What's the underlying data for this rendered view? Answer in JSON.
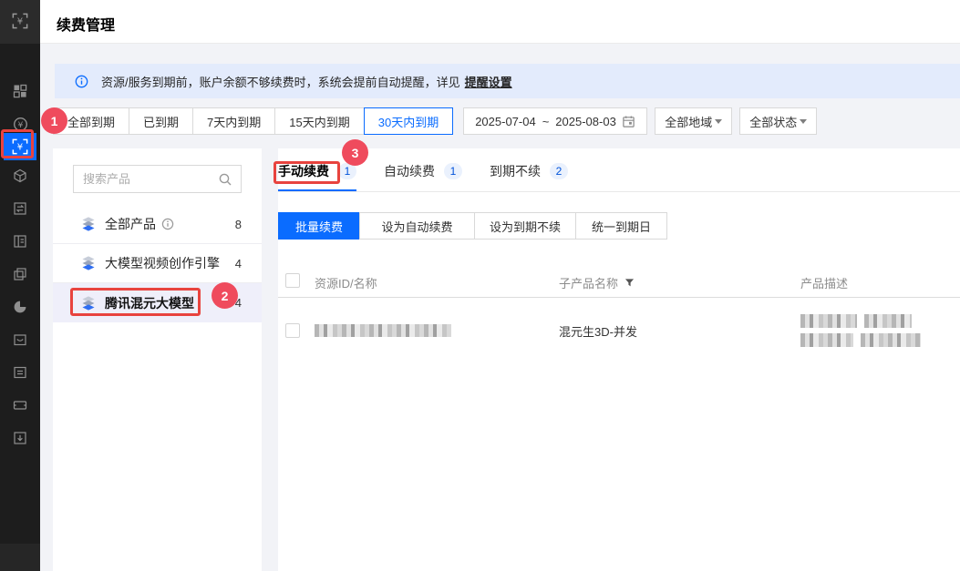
{
  "colors": {
    "accent_blue": "#0a6cff",
    "count_blue": "#0052d9",
    "annotation_box_red": "#e8433e",
    "annotation_circle_red": "#ef4b5d",
    "banner_bg": "#e3ebfc",
    "page_bg": "#f2f3f7",
    "sidebar_bg": "#1d1d1d",
    "selected_item_bg": "#efeffa"
  },
  "sidebar": {
    "top_icon": "billing-bracket-yen-icon",
    "active_icon": "renewal-bracket-yen-icon",
    "icons": [
      "dashboard-grid-icon",
      "coin-yen-icon",
      "renewal-bracket-yen-icon",
      "cube-icon",
      "transfer-doc-icon",
      "panel-doc-icon",
      "layers-icon",
      "pie-chart-icon",
      "envelope-icon",
      "list-doc-icon",
      "ticket-icon",
      "download-box-icon"
    ]
  },
  "header": {
    "title": "续费管理"
  },
  "banner": {
    "text": "资源/服务到期前，账户余额不够续费时，系统会提前自动提醒，详见",
    "link": "提醒设置"
  },
  "filters": {
    "expiry_tabs": [
      "全部到期",
      "已到期",
      "7天内到期",
      "15天内到期",
      "30天内到期"
    ],
    "selected": "30天内到期",
    "date_start": "2025-07-04",
    "date_separator": "~",
    "date_end": "2025-08-03",
    "region": "全部地域",
    "status": "全部状态"
  },
  "product_panel": {
    "search_placeholder": "搜索产品",
    "items": [
      {
        "label": "全部产品",
        "count": "8",
        "has_info_icon": true,
        "selected": false
      },
      {
        "label": "大模型视频创作引擎",
        "count": "4",
        "selected": false
      },
      {
        "label": "腾讯混元大模型",
        "count": "4",
        "selected": true
      }
    ]
  },
  "tabs": [
    {
      "label": "手动续费",
      "count": "1",
      "selected": true
    },
    {
      "label": "自动续费",
      "count": "1",
      "selected": false
    },
    {
      "label": "到期不续",
      "count": "2",
      "selected": false
    }
  ],
  "toolbar": {
    "primary": "批量续费",
    "buttons": [
      "设为自动续费",
      "设为到期不续",
      "统一到期日"
    ]
  },
  "table": {
    "columns": [
      "资源ID/名称",
      "子产品名称",
      "产品描述"
    ],
    "rows": [
      {
        "resource_id_redacted": true,
        "sub_product": "混元生3D-并发",
        "description_redacted": true
      }
    ]
  },
  "annotations": {
    "step1": "1",
    "step2": "2",
    "step3": "3"
  }
}
